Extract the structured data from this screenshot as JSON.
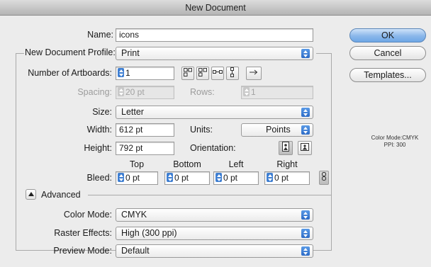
{
  "window": {
    "title": "New Document"
  },
  "form": {
    "name_label": "Name:",
    "name_value": "icons",
    "profile_label": "New Document Profile:",
    "profile_value": "Print",
    "artboards_label": "Number of Artboards:",
    "artboards_value": "1",
    "spacing_label": "Spacing:",
    "spacing_value": "20 pt",
    "rows_label": "Rows:",
    "rows_value": "1",
    "size_label": "Size:",
    "size_value": "Letter",
    "width_label": "Width:",
    "width_value": "612 pt",
    "units_label": "Units:",
    "units_value": "Points",
    "height_label": "Height:",
    "height_value": "792 pt",
    "orientation_label": "Orientation:",
    "bleed_label": "Bleed:",
    "bleed_headers": {
      "top": "Top",
      "bottom": "Bottom",
      "left": "Left",
      "right": "Right"
    },
    "bleed_values": {
      "top": "0 pt",
      "bottom": "0 pt",
      "left": "0 pt",
      "right": "0 pt"
    },
    "advanced_label": "Advanced",
    "color_mode_label": "Color Mode:",
    "color_mode_value": "CMYK",
    "raster_label": "Raster Effects:",
    "raster_value": "High (300 ppi)",
    "preview_label": "Preview Mode:",
    "preview_value": "Default"
  },
  "buttons": {
    "ok": "OK",
    "cancel": "Cancel",
    "templates": "Templates..."
  },
  "info": {
    "color_mode": "Color Mode:CMYK",
    "ppi": "PPI: 300"
  },
  "icons": {
    "grid_row": "grid-by-row-icon",
    "grid_col": "grid-by-column-icon",
    "arrange_row": "arrange-by-row-icon",
    "arrange_col": "arrange-by-column-icon",
    "layout_direction": "right-arrow-icon",
    "portrait": "portrait-orientation-icon",
    "landscape": "landscape-orientation-icon",
    "link": "chain-link-icon",
    "disclosure": "disclosure-triangle-icon"
  },
  "colors": {
    "accent": "#3f7fd2",
    "default_button": "#8ab7ea",
    "dialog_bg": "#ececec"
  }
}
